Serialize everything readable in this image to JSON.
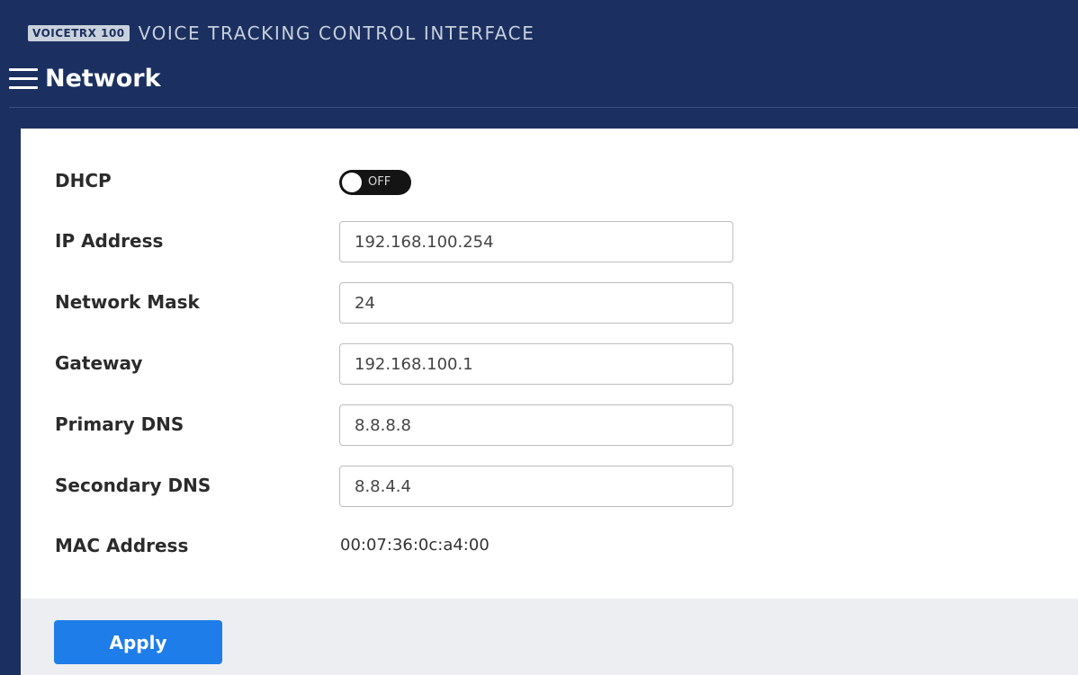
{
  "header": {
    "brand_badge": "VOICETRX 100",
    "brand_title": "VOICE TRACKING CONTROL INTERFACE",
    "page_title": "Network"
  },
  "dhcp": {
    "label": "DHCP",
    "state": "OFF",
    "enabled": false
  },
  "fields": {
    "ip_address": {
      "label": "IP Address",
      "value": "192.168.100.254"
    },
    "network_mask": {
      "label": "Network Mask",
      "value": "24"
    },
    "gateway": {
      "label": "Gateway",
      "value": "192.168.100.1"
    },
    "primary_dns": {
      "label": "Primary DNS",
      "value": "8.8.8.8"
    },
    "secondary_dns": {
      "label": "Secondary DNS",
      "value": "8.8.4.4"
    }
  },
  "mac": {
    "label": "MAC Address",
    "value": "00:07:36:0c:a4:00"
  },
  "footer": {
    "apply_label": "Apply"
  },
  "colors": {
    "header_bg": "#1b3060",
    "accent": "#1f7de9",
    "footer_bg": "#edeef1"
  },
  "icons": {
    "menu": "hamburger-menu-icon"
  }
}
